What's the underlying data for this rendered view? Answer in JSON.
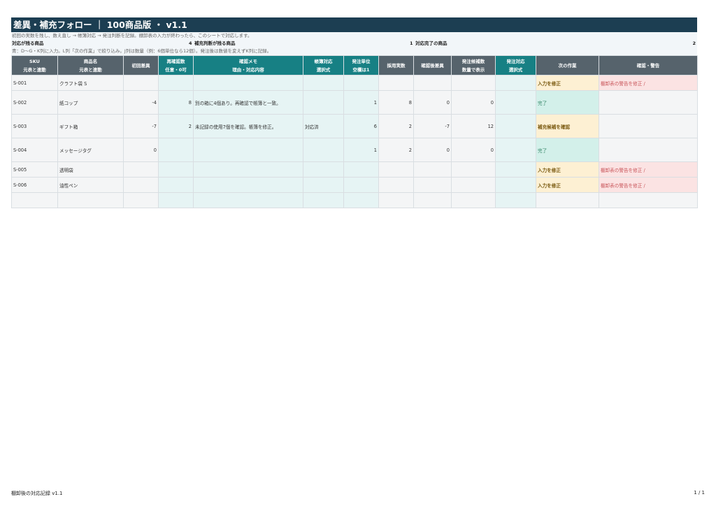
{
  "title": "差異・補充フォロー ｜ 100商品版 ・ v1.1",
  "subtitle": "初回の実数を残し、数え直し → 帳簿対応 → 発注判断を記録。棚卸表の入力が終わったら、このシートで対応します。",
  "stats": {
    "remaining_label": "対応が残る商品",
    "replenish_count": "4",
    "replenish_label": "補充判断が残る商品",
    "done_count": "1",
    "done_label": "対応完了の商品",
    "right_value": "2"
  },
  "instructions": "青：D〜G・K列に入力。L列「次の作業」で絞り込み。J列は数量（例：6個単位なら12個）。発注後は数値を変えずK列に記録。",
  "headers": [
    {
      "l1": "SKU",
      "l2": "元表と連動"
    },
    {
      "l1": "商品名",
      "l2": "元表と連動"
    },
    {
      "l1": "初回差異",
      "l2": ""
    },
    {
      "l1": "再確認数",
      "l2": "任意・0可"
    },
    {
      "l1": "確認メモ",
      "l2": "理由・対応内容"
    },
    {
      "l1": "帳簿対応",
      "l2": "選択式"
    },
    {
      "l1": "発注単位",
      "l2": "空欄は1"
    },
    {
      "l1": "採用実数",
      "l2": ""
    },
    {
      "l1": "確認後差異",
      "l2": ""
    },
    {
      "l1": "発注候補数",
      "l2": "数量で表示"
    },
    {
      "l1": "発注対応",
      "l2": "選択式"
    },
    {
      "l1": "次の作業",
      "l2": ""
    },
    {
      "l1": "確認・警告",
      "l2": ""
    }
  ],
  "rows": [
    {
      "sku": "S-001",
      "name": "クラフト袋 S",
      "diff": "",
      "recount": "",
      "memo": "",
      "ledger": "",
      "unit": "",
      "actual": "",
      "post_diff": "",
      "order_qty": "",
      "order_action": "",
      "next": "入力を修正",
      "warning": "棚卸表の警告を修正 /"
    },
    {
      "sku": "S-002",
      "name": "紙コップ",
      "diff": "-4",
      "recount": "8",
      "memo": "別の箱に4個あり。再確認で帳簿と一致。",
      "ledger": "",
      "unit": "1",
      "actual": "8",
      "post_diff": "0",
      "order_qty": "0",
      "order_action": "",
      "next": "完了",
      "warning": ""
    },
    {
      "sku": "S-003",
      "name": "ギフト箱",
      "diff": "-7",
      "recount": "2",
      "memo": "未記録の使用7個を確認。帳簿を修正。",
      "ledger": "対応済",
      "unit": "6",
      "actual": "2",
      "post_diff": "-7",
      "order_qty": "12",
      "order_action": "",
      "next": "補充候補を確認",
      "warning": ""
    },
    {
      "sku": "S-004",
      "name": "メッセージタグ",
      "diff": "0",
      "recount": "",
      "memo": "",
      "ledger": "",
      "unit": "1",
      "actual": "2",
      "post_diff": "0",
      "order_qty": "0",
      "order_action": "",
      "next": "完了",
      "warning": ""
    },
    {
      "sku": "S-005",
      "name": "透明袋",
      "diff": "",
      "recount": "",
      "memo": "",
      "ledger": "",
      "unit": "",
      "actual": "",
      "post_diff": "",
      "order_qty": "",
      "order_action": "",
      "next": "入力を修正",
      "warning": "棚卸表の警告を修正 /"
    },
    {
      "sku": "S-006",
      "name": "油性ペン",
      "diff": "",
      "recount": "",
      "memo": "",
      "ledger": "",
      "unit": "",
      "actual": "",
      "post_diff": "",
      "order_qty": "",
      "order_action": "",
      "next": "入力を修正",
      "warning": "棚卸表の警告を修正 /"
    }
  ],
  "footer": {
    "left": "棚卸後の対応記録 v1.1",
    "right": "1 / 1"
  }
}
